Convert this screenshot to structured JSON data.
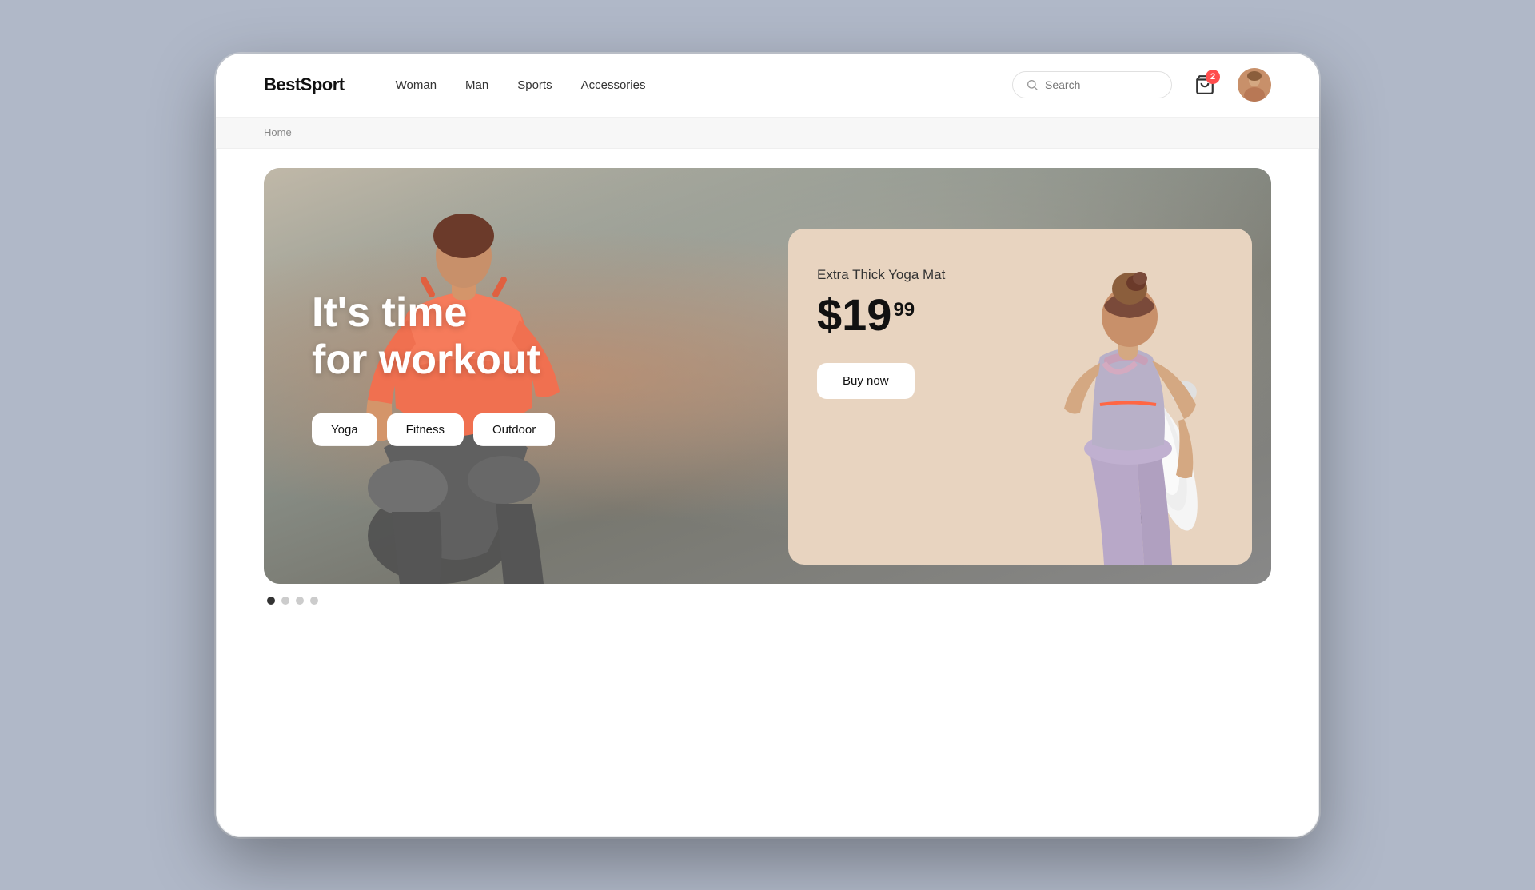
{
  "brand": {
    "logo": "BestSport"
  },
  "navbar": {
    "links": [
      {
        "label": "Woman",
        "id": "woman"
      },
      {
        "label": "Man",
        "id": "man"
      },
      {
        "label": "Sports",
        "id": "sports"
      },
      {
        "label": "Accessories",
        "id": "accessories"
      }
    ],
    "search": {
      "placeholder": "Search"
    },
    "cart": {
      "badge": "2"
    }
  },
  "breadcrumb": {
    "text": "Home"
  },
  "hero": {
    "title_line1": "It's time",
    "title_line2": "for workout",
    "buttons": [
      {
        "label": "Yoga",
        "id": "yoga"
      },
      {
        "label": "Fitness",
        "id": "fitness"
      },
      {
        "label": "Outdoor",
        "id": "outdoor"
      }
    ]
  },
  "product_card": {
    "name": "Extra Thick Yoga Mat",
    "price_main": "$19",
    "price_cents": "99",
    "buy_label": "Buy now"
  },
  "pagination": {
    "dots": [
      true,
      false,
      false,
      false
    ]
  }
}
